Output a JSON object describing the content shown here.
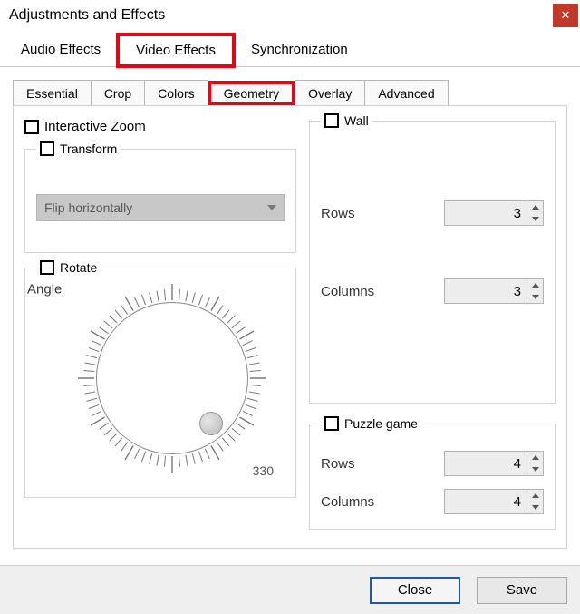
{
  "title": "Adjustments and Effects",
  "closeGlyph": "✕",
  "mainTabs": {
    "audio": "Audio Effects",
    "video": "Video Effects",
    "sync": "Synchronization"
  },
  "subTabs": {
    "essential": "Essential",
    "crop": "Crop",
    "colors": "Colors",
    "geometry": "Geometry",
    "overlay": "Overlay",
    "advanced": "Advanced"
  },
  "geometry": {
    "interactiveZoom": "Interactive Zoom",
    "transform": {
      "title": "Transform",
      "selected": "Flip horizontally"
    },
    "rotate": {
      "title": "Rotate",
      "angleLabel": "Angle",
      "number330": "330"
    },
    "wall": {
      "title": "Wall",
      "rowsLabel": "Rows",
      "rowsValue": "3",
      "colsLabel": "Columns",
      "colsValue": "3"
    },
    "puzzle": {
      "title": "Puzzle game",
      "rowsLabel": "Rows",
      "rowsValue": "4",
      "colsLabel": "Columns",
      "colsValue": "4"
    }
  },
  "buttons": {
    "close": "Close",
    "save": "Save"
  }
}
